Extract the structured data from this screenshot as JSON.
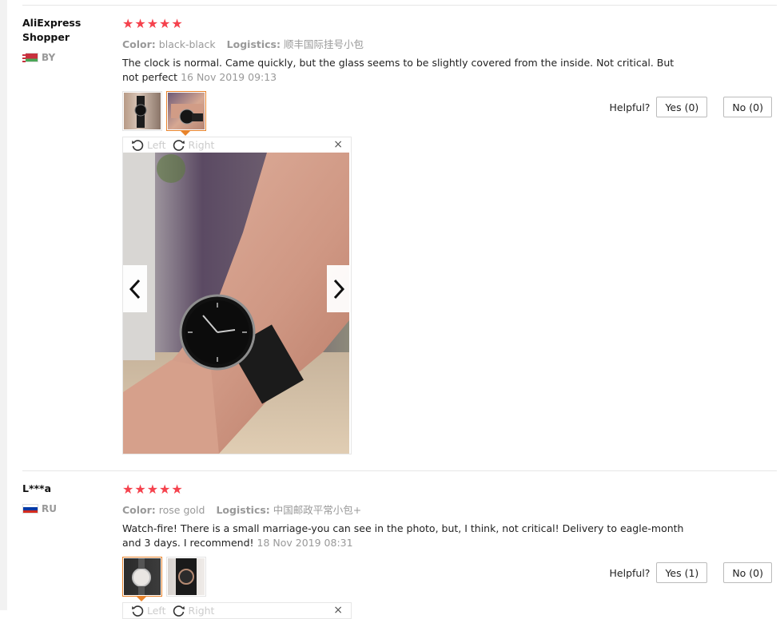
{
  "reviews": [
    {
      "user": "AliExpress\nShopper",
      "country": "BY",
      "stars": 5,
      "color_label": "Color:",
      "color_value": "black-black",
      "logistics_label": "Logistics:",
      "logistics_value": "顺丰国际挂号小包",
      "text": "The clock is normal. Came quickly, but the glass seems to be slightly covered from the inside. Not critical. But not perfect",
      "date": "16 Nov 2019 09:13",
      "helpful_label": "Helpful?",
      "yes_label": "Yes (0)",
      "no_label": "No (0)",
      "viewer": {
        "left_label": "Left",
        "right_label": "Right",
        "close": "×"
      }
    },
    {
      "user": "L***a",
      "country": "RU",
      "stars": 5,
      "color_label": "Color:",
      "color_value": "rose gold",
      "logistics_label": "Logistics:",
      "logistics_value": "中国邮政平常小包+",
      "text": "Watch-fire! There is a small marriage-you can see in the photo, but, I think, not critical! Delivery to eagle-month and 3 days. I recommend!",
      "date": "18 Nov 2019 08:31",
      "helpful_label": "Helpful?",
      "yes_label": "Yes (1)",
      "no_label": "No (0)",
      "viewer": {
        "left_label": "Left",
        "right_label": "Right",
        "close": "×"
      }
    }
  ],
  "colors": {
    "star": "#f5424d",
    "active_thumb": "#e8832b",
    "muted": "#999999"
  },
  "icons": [
    "star-icon",
    "rotate-left-icon",
    "rotate-right-icon",
    "close-icon",
    "chevron-left-icon",
    "chevron-right-icon",
    "flag-icon"
  ]
}
